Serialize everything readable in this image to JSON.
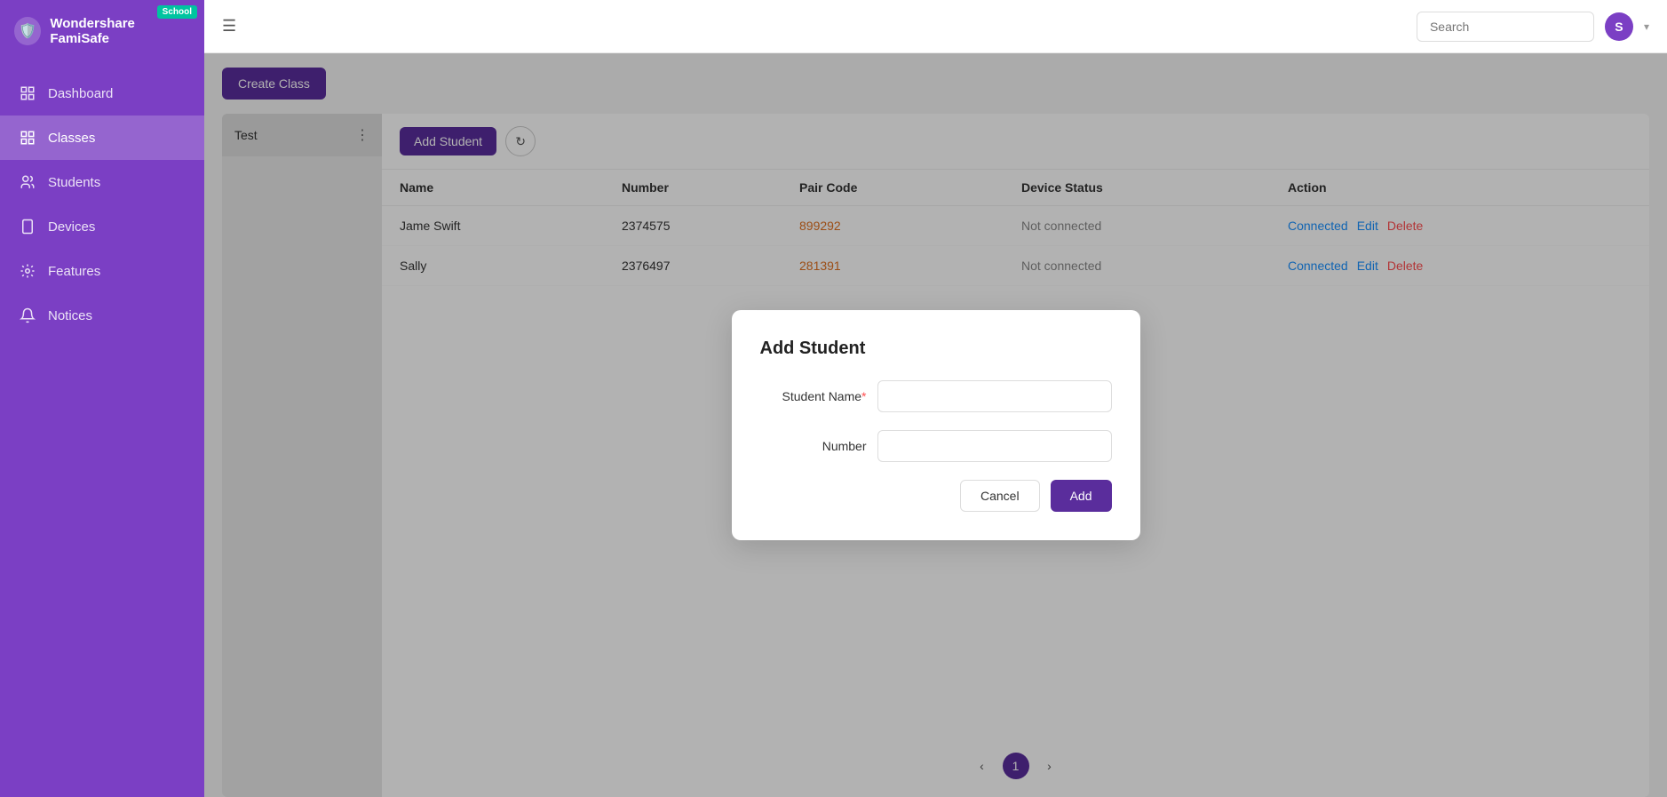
{
  "app": {
    "name": "Wondershare FamiSafe",
    "badge": "School",
    "user_initial": "S"
  },
  "sidebar": {
    "items": [
      {
        "id": "dashboard",
        "label": "Dashboard",
        "icon": "🏠",
        "active": false
      },
      {
        "id": "classes",
        "label": "Classes",
        "icon": "⬛",
        "active": true
      },
      {
        "id": "students",
        "label": "Students",
        "icon": "👥",
        "active": false
      },
      {
        "id": "devices",
        "label": "Devices",
        "icon": "📱",
        "active": false
      },
      {
        "id": "features",
        "label": "Features",
        "icon": "🔧",
        "active": false
      },
      {
        "id": "notices",
        "label": "Notices",
        "icon": "🔔",
        "active": false
      }
    ]
  },
  "topbar": {
    "search_placeholder": "Search"
  },
  "toolbar": {
    "create_class_label": "Create Class"
  },
  "class_panel": {
    "class_name": "Test"
  },
  "table": {
    "columns": [
      "Name",
      "Number",
      "Pair Code",
      "Device Status",
      "Action"
    ],
    "rows": [
      {
        "name": "Jame Swift",
        "number": "2374575",
        "pair_code": "899292",
        "device_status": "Not connected",
        "actions": [
          "Connected",
          "Edit",
          "Delete"
        ]
      },
      {
        "name": "Sally",
        "number": "2376497",
        "pair_code": "281391",
        "device_status": "Not connected",
        "actions": [
          "Connected",
          "Edit",
          "Delete"
        ]
      }
    ]
  },
  "pagination": {
    "current": "1",
    "prev_icon": "‹",
    "next_icon": "›"
  },
  "modal": {
    "title": "Add Student",
    "student_name_label": "Student Name",
    "student_name_required": "*",
    "number_label": "Number",
    "cancel_label": "Cancel",
    "add_label": "Add"
  },
  "buttons": {
    "add_student": "Add Student",
    "refresh_icon": "↻"
  }
}
